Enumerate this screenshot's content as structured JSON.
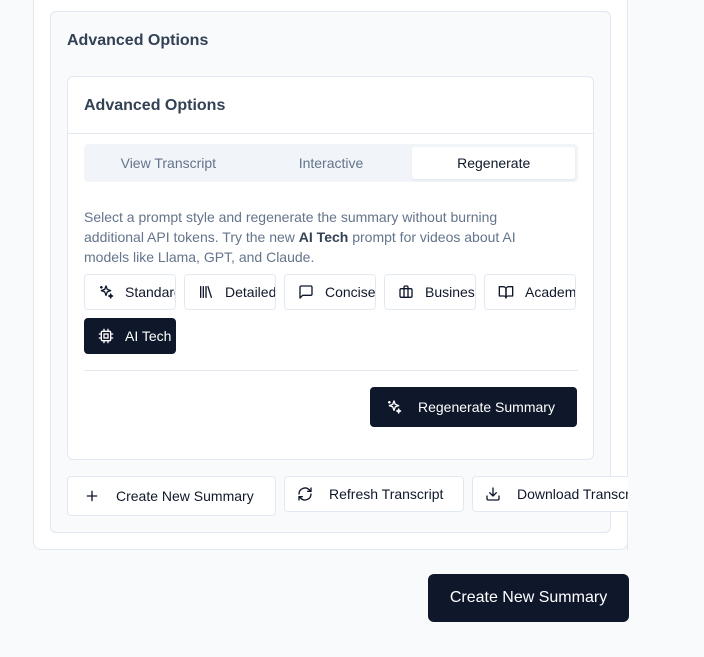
{
  "section": {
    "title": "Advanced Options"
  },
  "advanced": {
    "title": "Advanced Options",
    "tabs": [
      {
        "label": "View Transcript",
        "active": false
      },
      {
        "label": "Interactive",
        "active": false
      },
      {
        "label": "Regenerate",
        "active": true
      }
    ],
    "description": {
      "before": "Select a prompt style and regenerate the summary without burning additional API tokens. Try the new ",
      "highlight": "AI Tech",
      "after": " prompt for videos about AI models like Llama, GPT, and Claude."
    },
    "styles": [
      {
        "label": "Standard",
        "icon": "sparkles-icon",
        "selected": false
      },
      {
        "label": "Detailed",
        "icon": "library-icon",
        "selected": false
      },
      {
        "label": "Concise",
        "icon": "message-square-icon",
        "selected": false
      },
      {
        "label": "Business",
        "icon": "briefcase-icon",
        "selected": false
      },
      {
        "label": "Academic",
        "icon": "book-open-icon",
        "selected": false
      },
      {
        "label": "AI Tech",
        "icon": "cpu-icon",
        "selected": true
      }
    ],
    "regenerate_label": "Regenerate Summary"
  },
  "actions": {
    "create_label": "Create New Summary",
    "refresh_label": "Refresh Transcript",
    "download_label": "Download Transcript"
  },
  "main_button_label": "Create New Summary",
  "colors": {
    "primary": "#0f172a",
    "border": "#e2e8f0",
    "muted_text": "#64748b",
    "background": "#f8fafc"
  }
}
